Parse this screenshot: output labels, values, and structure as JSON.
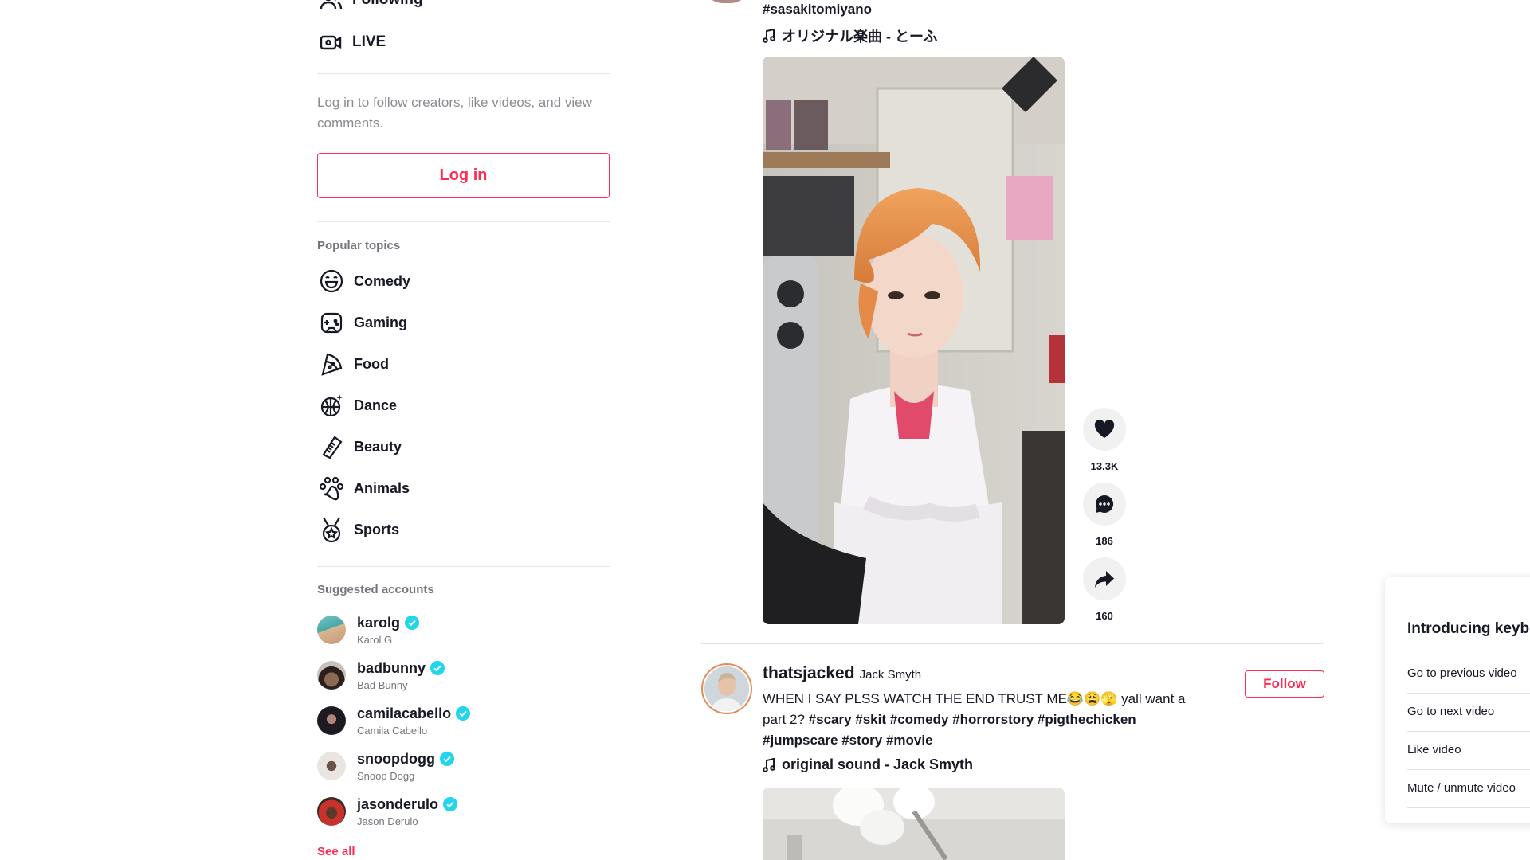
{
  "sidebar": {
    "nav": [
      {
        "label": "Following",
        "icon": "following-icon"
      },
      {
        "label": "LIVE",
        "icon": "live-icon"
      }
    ],
    "login_hint": "Log in to follow creators, like videos, and view comments.",
    "login_button": "Log in",
    "popular_topics_title": "Popular topics",
    "topics": [
      {
        "label": "Comedy",
        "icon": "comedy-icon"
      },
      {
        "label": "Gaming",
        "icon": "gaming-icon"
      },
      {
        "label": "Food",
        "icon": "food-icon"
      },
      {
        "label": "Dance",
        "icon": "dance-icon"
      },
      {
        "label": "Beauty",
        "icon": "beauty-icon"
      },
      {
        "label": "Animals",
        "icon": "animals-icon"
      },
      {
        "label": "Sports",
        "icon": "sports-icon"
      }
    ],
    "suggested_title": "Suggested accounts",
    "accounts": [
      {
        "username": "karolg",
        "name": "Karol G"
      },
      {
        "username": "badbunny",
        "name": "Bad Bunny"
      },
      {
        "username": "camilacabello",
        "name": "Camila Cabello"
      },
      {
        "username": "snoopdogg",
        "name": "Snoop Dogg"
      },
      {
        "username": "jasonderulo",
        "name": "Jason Derulo"
      }
    ],
    "see_all": "See all"
  },
  "post1": {
    "hashtag": "#sasakitomiyano",
    "music": "オリジナル楽曲 - とーふ",
    "likes": "13.3K",
    "comments": "186",
    "shares": "160"
  },
  "post2": {
    "username": "thatsjacked",
    "display_name": "Jack Smyth",
    "follow": "Follow",
    "caption_text": "WHEN I SAY PLSS WATCH THE END TRUST ME😂😩🫣 yall want a part 2? ",
    "caption_tags": "#scary #skit #comedy #horrorstory #pigthechicken #jumpscare #story #movie",
    "music": "original sound - Jack Smyth"
  },
  "keyboard_panel": {
    "title": "Introducing keyb",
    "rows": [
      "Go to previous video",
      "Go to next video",
      "Like video",
      "Mute / unmute video"
    ]
  },
  "colors": {
    "accent": "#fe2c55",
    "verified": "#20d5ec",
    "text": "#161823",
    "muted": "#8a8b91"
  }
}
